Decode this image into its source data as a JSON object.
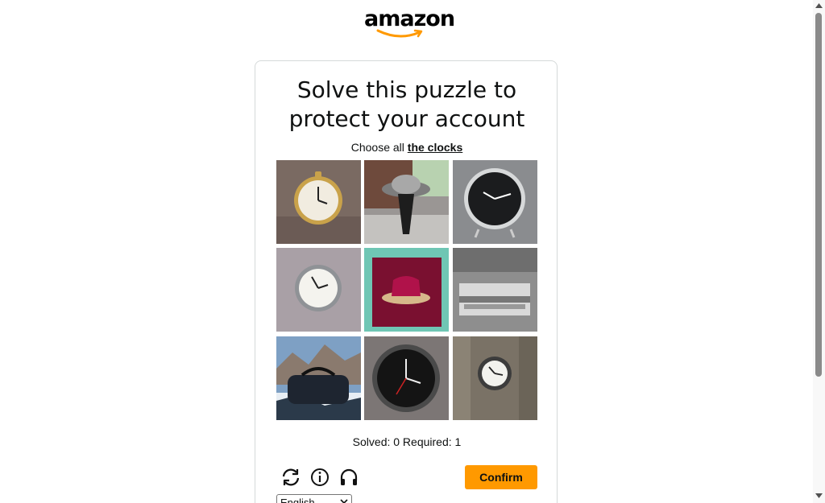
{
  "logo": {
    "text": "amazon",
    "brand_color": "#ff9900"
  },
  "puzzle": {
    "title_line1": "Solve this puzzle to",
    "title_line2": "protect your account",
    "instruction_prefix": "Choose all",
    "instruction_target": "the clocks",
    "tiles": [
      {
        "icon": "pocket-watch-image"
      },
      {
        "icon": "lamp-image"
      },
      {
        "icon": "black-clock-image"
      },
      {
        "icon": "wall-clock-image"
      },
      {
        "icon": "red-hat-image"
      },
      {
        "icon": "gray-box-image"
      },
      {
        "icon": "duffel-bag-image"
      },
      {
        "icon": "dark-clock-image"
      },
      {
        "icon": "post-clock-image"
      }
    ],
    "status": "Solved: 0 Required: 1",
    "confirm_label": "Confirm",
    "language": "English"
  },
  "colors": {
    "confirm": "#ff9900",
    "card_border": "#d5d9d9"
  }
}
